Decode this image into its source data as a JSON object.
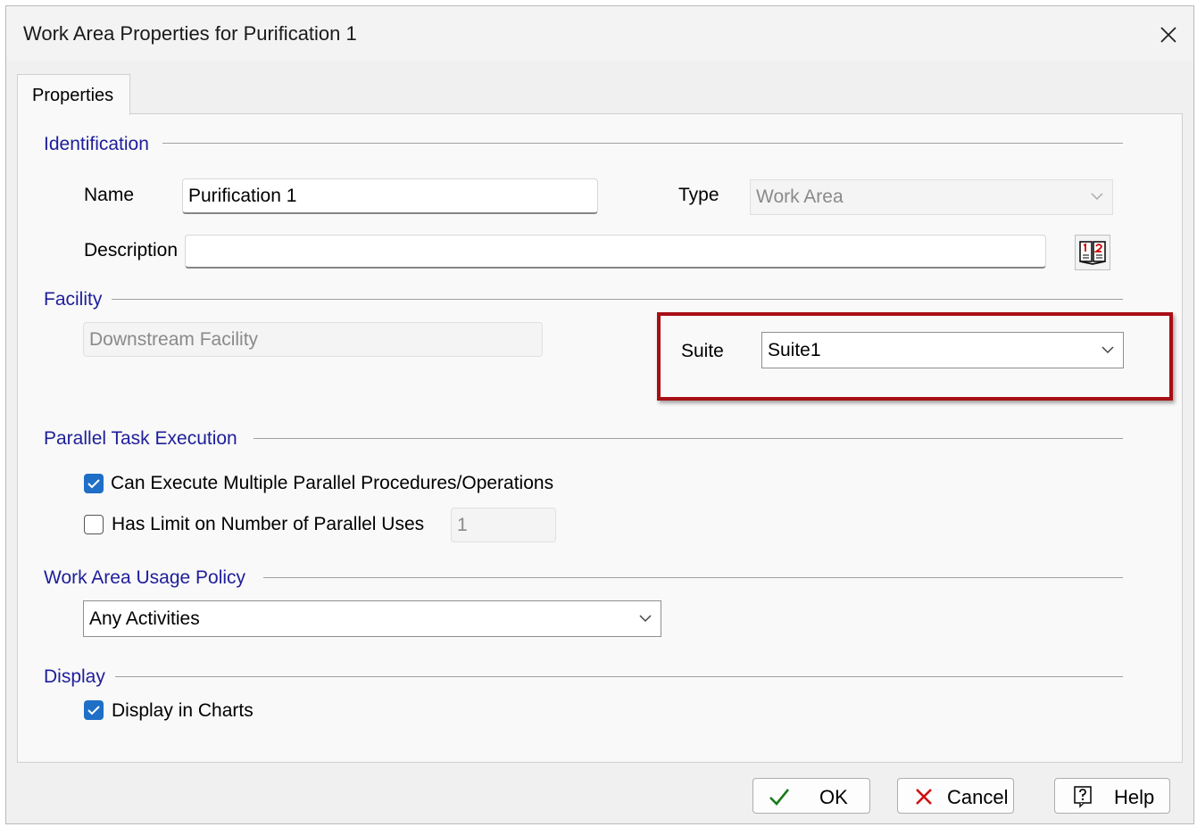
{
  "window": {
    "title": "Work Area Properties for Purification 1"
  },
  "tabs": [
    {
      "label": "Properties"
    }
  ],
  "identification": {
    "title": "Identification",
    "name_label": "Name",
    "name_value": "Purification 1",
    "type_label": "Type",
    "type_value": "Work Area",
    "description_label": "Description",
    "description_value": ""
  },
  "facility": {
    "title": "Facility",
    "facility_value": "Downstream Facility",
    "suite_label": "Suite",
    "suite_value": "Suite1"
  },
  "parallel": {
    "title": "Parallel Task Execution",
    "multi_label": "Can Execute Multiple Parallel Procedures/Operations",
    "multi_checked": true,
    "limit_label": "Has Limit on Number of Parallel Uses",
    "limit_checked": false,
    "limit_value": "1"
  },
  "usage_policy": {
    "title": "Work Area Usage Policy",
    "value": "Any Activities"
  },
  "display": {
    "title": "Display",
    "charts_label": "Display in Charts",
    "charts_checked": true
  },
  "buttons": {
    "ok": "OK",
    "cancel": "Cancel",
    "help": "Help"
  },
  "colors": {
    "accent": "#1f6fc7",
    "group_title": "#1e1e9a",
    "highlight": "#a80f15",
    "ok_check": "#1a7a1a",
    "cancel_x": "#d01010"
  }
}
